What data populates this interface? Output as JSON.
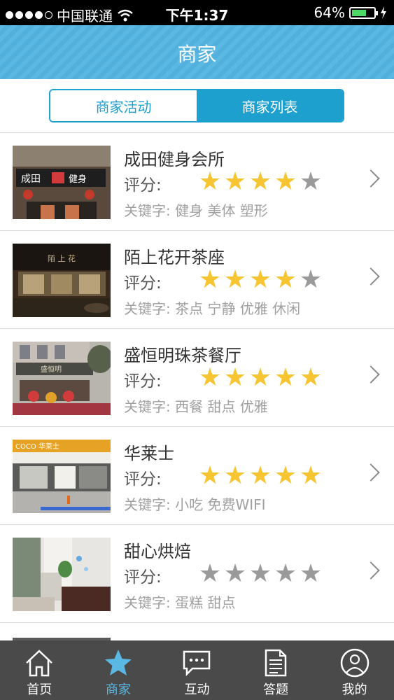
{
  "status_bar": {
    "carrier": "中国联通",
    "time": "下午1:37",
    "battery": "64%"
  },
  "header": {
    "title": "商家"
  },
  "segments": [
    {
      "label": "商家活动",
      "active": false
    },
    {
      "label": "商家列表",
      "active": true
    }
  ],
  "merchants": [
    {
      "name": "成田健身会所",
      "rating_label": "评分:",
      "stars": 4,
      "keywords": "关键字: 健身 美体 塑形"
    },
    {
      "name": "陌上花开茶座",
      "rating_label": "评分:",
      "stars": 4,
      "keywords": "关键字: 茶点 宁静 优雅 休闲"
    },
    {
      "name": "盛恒明珠茶餐厅",
      "rating_label": "评分:",
      "stars": 5,
      "keywords": "关键字: 西餐 甜点 优雅"
    },
    {
      "name": "华莱士",
      "rating_label": "评分:",
      "stars": 5,
      "keywords": "关键字: 小吃 免费WIFI"
    },
    {
      "name": "甜心烘焙",
      "rating_label": "评分:",
      "stars": 0,
      "keywords": "关键字: 蛋糕 甜点"
    }
  ],
  "tabbar": [
    {
      "label": "首页",
      "icon": "home-icon",
      "active": false
    },
    {
      "label": "商家",
      "icon": "star-icon",
      "active": true
    },
    {
      "label": "互动",
      "icon": "chat-icon",
      "active": false
    },
    {
      "label": "答题",
      "icon": "document-icon",
      "active": false
    },
    {
      "label": "我的",
      "icon": "profile-icon",
      "active": false
    }
  ],
  "colors": {
    "accent": "#1ea0cf",
    "header": "#5bb8e2",
    "star_on": "#f7c531",
    "star_off": "#9a9a9a",
    "tabbar": "#4a4a4a"
  }
}
